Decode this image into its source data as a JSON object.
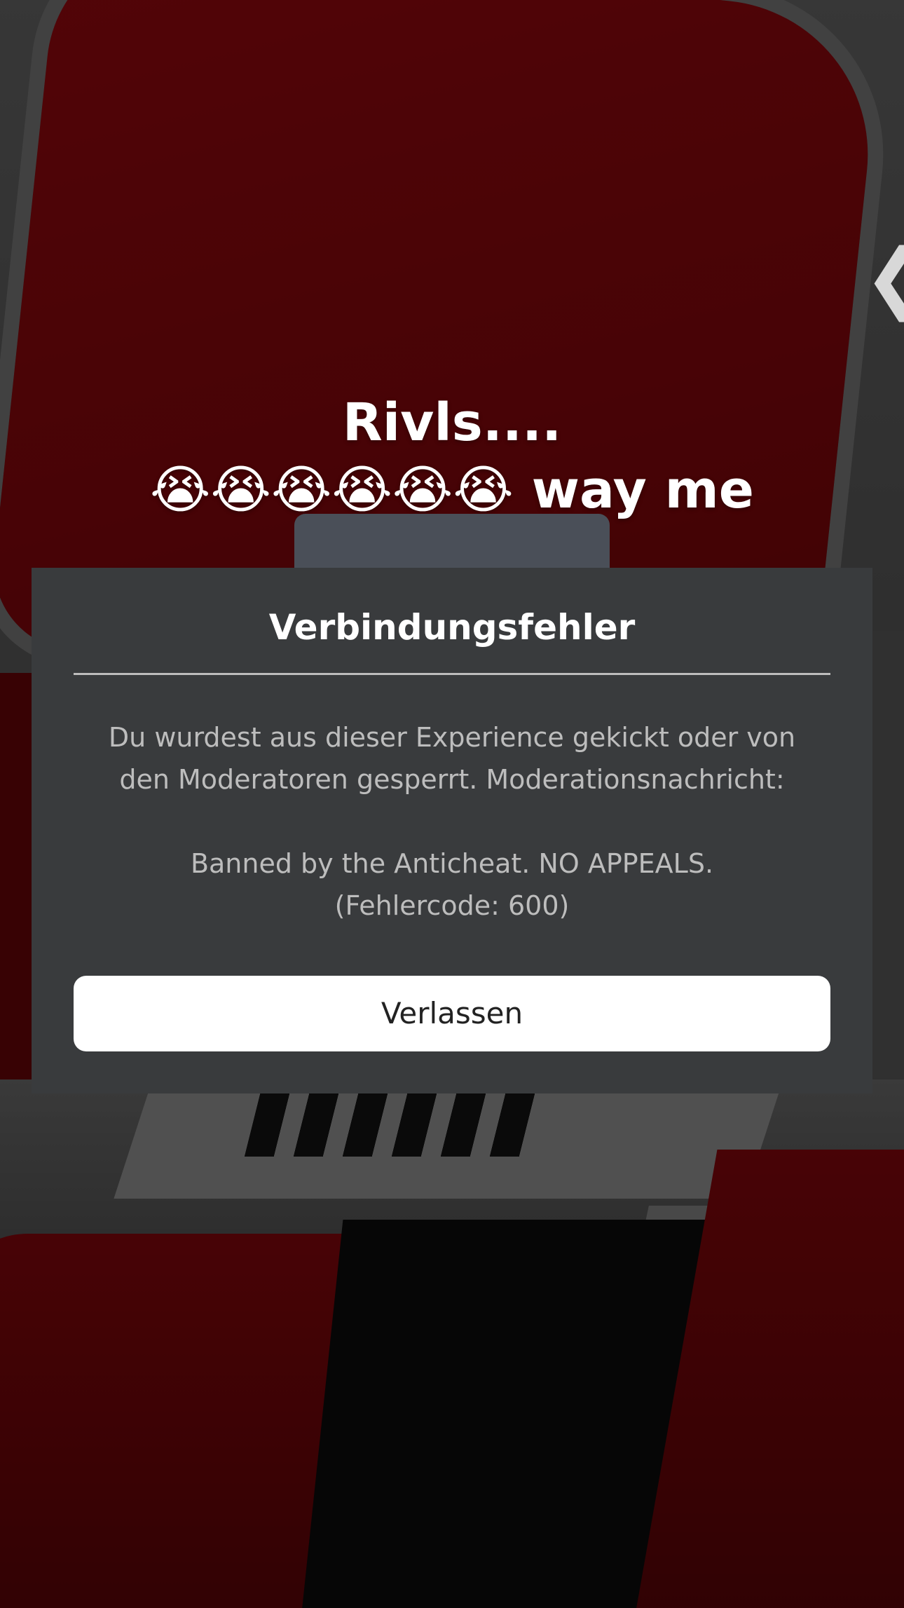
{
  "caption": {
    "line1": "Rivls....",
    "line2": "😭😭😭😭😭😭 way me"
  },
  "nav": {
    "back_glyph": "❮"
  },
  "dialog": {
    "title": "Verbindungsfehler",
    "message_line1": "Du wurdest aus dieser Experience gekickt oder von",
    "message_line2": "den Moderatoren gesperrt. Moderationsnachricht:",
    "message_line3": "Banned by the Anticheat. NO APPEALS.",
    "message_line4": "(Fehlercode: 600)",
    "leave_label": "Verlassen"
  },
  "colors": {
    "dialog_bg": "#393b3d",
    "button_bg": "#ffffff",
    "accent_red": "#8a070c"
  }
}
